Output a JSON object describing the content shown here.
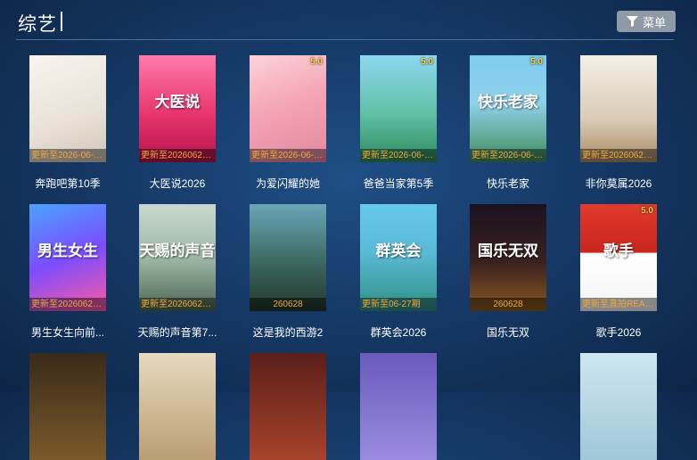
{
  "header": {
    "title": "综艺",
    "menu_label": "菜单"
  },
  "cards": [
    {
      "name": "奔跑吧第10季",
      "update": "更新至2026-06-2...",
      "rating": "",
      "art_text": "",
      "bg": "linear-gradient(160deg,#f7f4ee 0%,#e9e1d6 60%,#cfc4b6 100%)"
    },
    {
      "name": "大医说2026",
      "update": "更新至20260628...",
      "rating": "",
      "art_text": "大医说",
      "bg": "linear-gradient(180deg,#ff7aa9 0%,#e7356f 55%,#b5134c 100%)"
    },
    {
      "name": "为爱闪耀的她",
      "update": "更新至2026-06-2...",
      "rating": "5.0",
      "art_text": "",
      "bg": "linear-gradient(160deg,#fcd3d9 0%,#f4a6b5 45%,#e3889e 100%)"
    },
    {
      "name": "爸爸当家第5季",
      "update": "更新至2026-06-2...",
      "rating": "5.0",
      "art_text": "",
      "bg": "linear-gradient(180deg,#8fd7f2 0%,#5ec0a3 55%,#2f8a5d 100%)"
    },
    {
      "name": "快乐老家",
      "update": "更新至2026-06-2...",
      "rating": "5.0",
      "art_text": "快乐老家",
      "bg": "linear-gradient(180deg,#7ecbf0 0%,#8fd1e8 45%,#3d8c5a 100%)"
    },
    {
      "name": "非你莫属2026",
      "update": "更新至20260621...",
      "rating": "",
      "art_text": "",
      "bg": "linear-gradient(180deg,#f4efe6 0%,#d9cbb5 60%,#a98a62 100%)"
    },
    {
      "name": "男生女生向前...",
      "update": "更新至20260629...",
      "rating": "",
      "art_text": "男生女生",
      "bg": "linear-gradient(160deg,#4aa3ff 0%,#7b4dff 50%,#ff5aa0 100%)"
    },
    {
      "name": "天赐的声音第7...",
      "update": "更新至20260629...",
      "rating": "",
      "art_text": "天赐的声音",
      "bg": "linear-gradient(180deg,#c9d8cf 0%,#9fb8a5 50%,#4d6552 100%)"
    },
    {
      "name": "这是我的西游2",
      "update": "260628",
      "rating": "",
      "art_text": "",
      "bg": "linear-gradient(180deg,#6aa6b8 0%,#3f6d66 50%,#22372c 100%)"
    },
    {
      "name": "群英会2026",
      "update": "更新至06-27期",
      "rating": "",
      "art_text": "群英会",
      "bg": "linear-gradient(180deg,#66c8ec 0%,#5bbad6 45%,#2f8f84 100%)"
    },
    {
      "name": "国乐无双",
      "update": "260628",
      "rating": "",
      "art_text": "国乐无双",
      "bg": "linear-gradient(180deg,#1a1220 0%,#3b2220 55%,#8a5a1e 100%)"
    },
    {
      "name": "歌手2026",
      "update": "更新至直拍REAC...",
      "rating": "5.0",
      "art_text": "歌手",
      "bg": "linear-gradient(180deg,#e23a2e 0%,#c9261d 45%,#ffffff 46%,#f3f3f3 100%)"
    },
    {
      "name": "",
      "update": "",
      "rating": "",
      "art_text": "",
      "bg": "linear-gradient(180deg,#3a2a1a 0%,#7a5a2a 100%)"
    },
    {
      "name": "",
      "update": "",
      "rating": "",
      "art_text": "",
      "bg": "linear-gradient(180deg,#e7d9c0 0%,#b99e74 100%)"
    },
    {
      "name": "",
      "update": "",
      "rating": "",
      "art_text": "",
      "bg": "linear-gradient(180deg,#5a1f1a 0%,#a8432c 100%)"
    },
    {
      "name": "",
      "update": "",
      "rating": "",
      "art_text": "",
      "bg": "linear-gradient(180deg,#6a5bbd 0%,#9a8be0 100%)"
    },
    {
      "name": "",
      "update": "",
      "rating": "",
      "art_text": "",
      "bg": "linear-gradient(180deg,#cfe6f0 0%,#9fc7d8 100%)"
    }
  ]
}
